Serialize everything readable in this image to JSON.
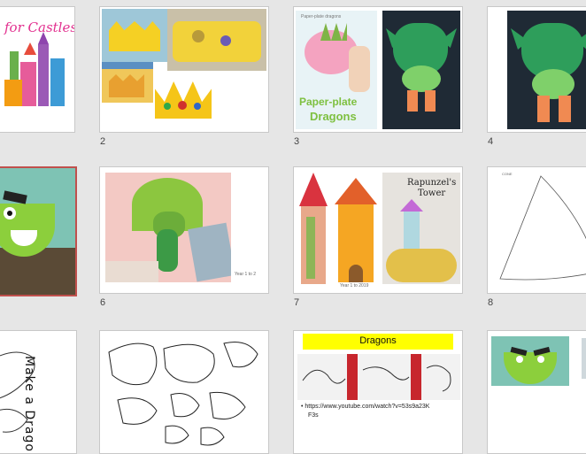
{
  "slides": [
    {
      "number": "",
      "title": "for Castles"
    },
    {
      "number": "2"
    },
    {
      "number": "3",
      "caption_line1": "Paper-plate",
      "caption_line2": "Dragons",
      "header": "Paper-plate dragons"
    },
    {
      "number": "4"
    },
    {
      "number": ""
    },
    {
      "number": "6",
      "footer": "Year 1 to 2"
    },
    {
      "number": "7",
      "title_line1": "Rapunzel's",
      "title_line2": "Tower",
      "footer": "Year 1 to 2019"
    },
    {
      "number": "8",
      "label": "CONE"
    },
    {
      "number": "",
      "title": "Make a Dragon"
    },
    {
      "number": ""
    },
    {
      "number": "",
      "banner": "Dragons",
      "bullet": "https://www.youtube.com/watch?v=53s9a23K",
      "bullet_cont": "F3s"
    },
    {
      "number": ""
    }
  ],
  "colors": {
    "selected_border": "#c0504d",
    "banner_yellow": "#ffff00"
  }
}
